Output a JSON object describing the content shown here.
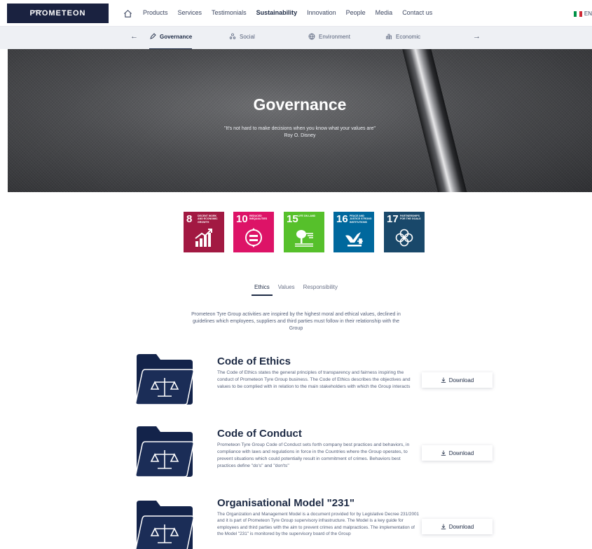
{
  "brand": {
    "logo": "PROMETEON"
  },
  "nav": {
    "items": [
      "Products",
      "Services",
      "Testimonials",
      "Sustainability",
      "Innovation",
      "People",
      "Media",
      "Contact us"
    ],
    "active": "Sustainability",
    "language": "EN"
  },
  "subnav": {
    "prev": "←",
    "next": "→",
    "tabs": [
      "Governance",
      "Social",
      "Environment",
      "Economic"
    ],
    "active": "Governance"
  },
  "hero": {
    "title": "Governance",
    "quote": "\"It's not hard to make decisions when you know what your values are\"",
    "author": "Roy O. Disney"
  },
  "sdgs": [
    {
      "number": "8",
      "label": "DECENT WORK AND ECONOMIC GROWTH",
      "color": "#a21942"
    },
    {
      "number": "10",
      "label": "REDUCED INEQUALITIES",
      "color": "#dd1367"
    },
    {
      "number": "15",
      "label": "LIFE ON LAND",
      "color": "#56c02b"
    },
    {
      "number": "16",
      "label": "PEACE AND JUSTICE STRONG INSTITUTIONS",
      "color": "#00689d"
    },
    {
      "number": "17",
      "label": "PARTNERSHIPS FOR THE GOALS",
      "color": "#19486a"
    }
  ],
  "tabs": {
    "items": [
      "Ethics",
      "Values",
      "Responsibility"
    ],
    "active": "Ethics"
  },
  "intro": "Prometeon Tyre Group activities are inspired by the highest moral and ethical values, declined in guidelines which employees, suppliers and third parties must follow in their relationship with the Group",
  "documents": [
    {
      "title": "Code of Ethics",
      "text": "The Code of Ethics states the general principles of transparency and fairness inspiring the conduct of Prometeon Tyre Group business. The Code of Ethics describes the objectives and values to be complied with in relation to the main stakeholders with which the Group interacts",
      "button": "Download"
    },
    {
      "title": "Code of Conduct",
      "text": "Prometeon Tyre Group Code of Conduct sets forth company best practices and behaviors, in compliance with laws and regulations in force in the Countries where the Group operates, to prevent situations which could potentially result in commitment of crimes. Behaviors best practices define \"do's\" and \"don'ts\"",
      "button": "Download"
    },
    {
      "title": "Organisational Model \"231\"",
      "text": "The Organization and Management Model is a document provided for by Legislative Decree 231/2001 and it is part of Prometeon Tyre Group supervisory infrastructure. The Model is a key guide for employees and third parties with the aim to prevent crimes and malpractices. The implementation of the Model \"231\" is monitored by the supervisory board of the Group",
      "button": "Download"
    }
  ],
  "colors": {
    "navy": "#1d2a44",
    "logo_bg": "#1a2240",
    "subnav_bg": "#eef0f4"
  }
}
